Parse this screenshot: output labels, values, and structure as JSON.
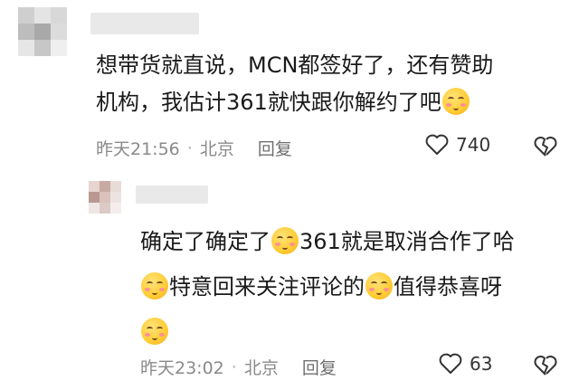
{
  "comments": [
    {
      "line1": "想带货就直说，MCN都签好了，还有赞助",
      "line2": "机构，我估计361就快跟你解约了吧",
      "time": "昨天21:56",
      "location": "北京",
      "reply_label": "回复",
      "likes": "740"
    },
    {
      "line1a": "确定了确定了",
      "line1b": "361就是取消合作了哈",
      "line2a": "特意回来关注评论的",
      "line2b": "值得恭喜呀",
      "time": "昨天23:02",
      "location": "北京",
      "reply_label": "回复",
      "likes": "63"
    }
  ],
  "separator": "·",
  "icons": [
    "heart-outline-icon",
    "broken-heart-icon",
    "squint-smile-emoji-icon",
    "blush-emoji-icon"
  ]
}
